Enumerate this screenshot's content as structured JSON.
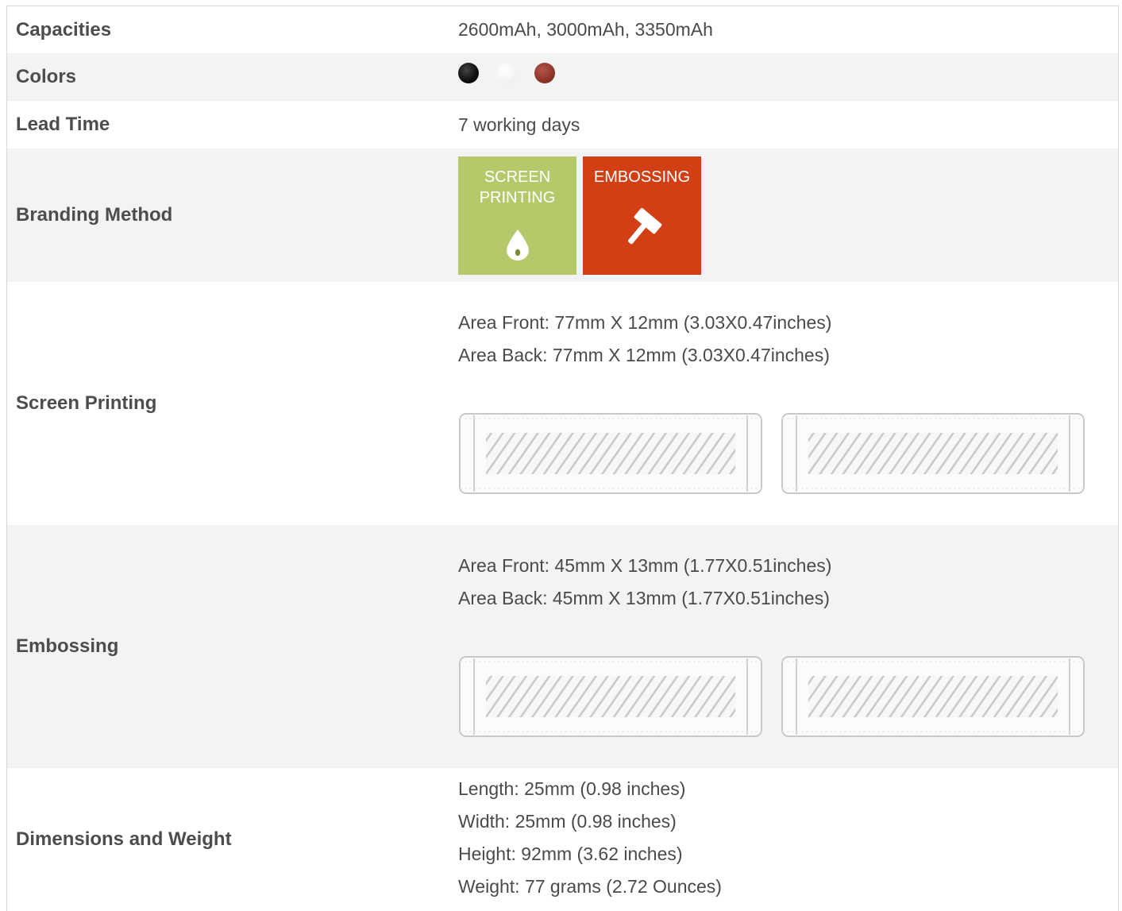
{
  "rows": {
    "capacities": {
      "label": "Capacities",
      "value": "2600mAh, 3000mAh, 3350mAh"
    },
    "colors": {
      "label": "Colors",
      "swatches": [
        {
          "name": "black",
          "color": "#111111"
        },
        {
          "name": "white",
          "color": "#f4f4f4"
        },
        {
          "name": "red",
          "color": "#8e3328"
        }
      ]
    },
    "lead_time": {
      "label": "Lead Time",
      "value": "7 working days"
    },
    "branding": {
      "label": "Branding Method",
      "tiles": [
        {
          "line1": "SCREEN",
          "line2": "PRINTING",
          "color": "#b5c96a",
          "icon": "ink-drop-icon"
        },
        {
          "line1": "EMBOSSING",
          "line2": "",
          "color": "#d23f14",
          "icon": "hammer-icon"
        }
      ]
    },
    "screen_printing": {
      "label": "Screen Printing",
      "area_front": "Area Front: 77mm X 12mm (3.03X0.47inches)",
      "area_back": "Area Back: 77mm X 12mm (3.03X0.47inches)"
    },
    "embossing": {
      "label": "Embossing",
      "area_front": "Area Front: 45mm X 13mm (1.77X0.51inches)",
      "area_back": "Area Back: 45mm X 13mm (1.77X0.51inches)"
    },
    "dimensions": {
      "label": "Dimensions and Weight",
      "length": "Length: 25mm (0.98 inches)",
      "width": "Width: 25mm (0.98 inches)",
      "height": "Height: 92mm (3.62 inches)",
      "weight": "Weight: 77 grams (2.72 Ounces)"
    }
  }
}
